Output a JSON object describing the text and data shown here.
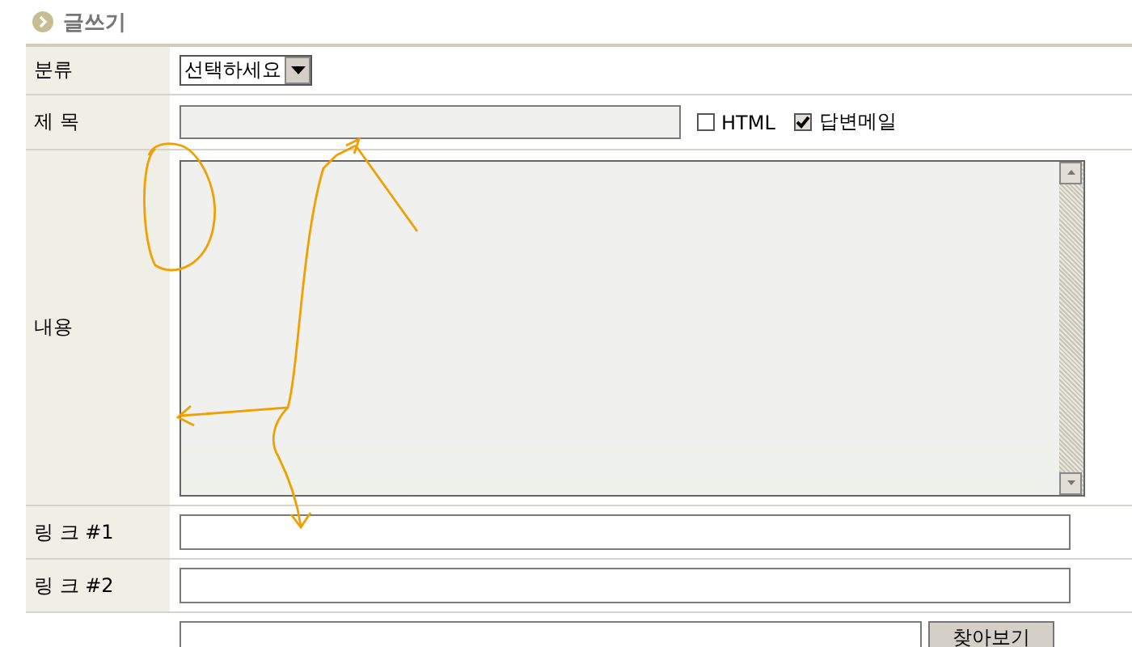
{
  "header": {
    "title": "글쓰기"
  },
  "form": {
    "rows": [
      {
        "kind": "select",
        "label": "분류",
        "value": "선택하세요"
      },
      {
        "kind": "subject",
        "label": "제 목",
        "checkboxes": [
          {
            "label": "HTML",
            "checked": false
          },
          {
            "label": "답변메일",
            "checked": true
          }
        ]
      },
      {
        "kind": "textarea",
        "label": "내용"
      },
      {
        "kind": "text",
        "label": "링 크 #1"
      },
      {
        "kind": "text",
        "label": "링 크 #2"
      },
      {
        "kind": "file",
        "button": "찾아보기"
      }
    ]
  }
}
